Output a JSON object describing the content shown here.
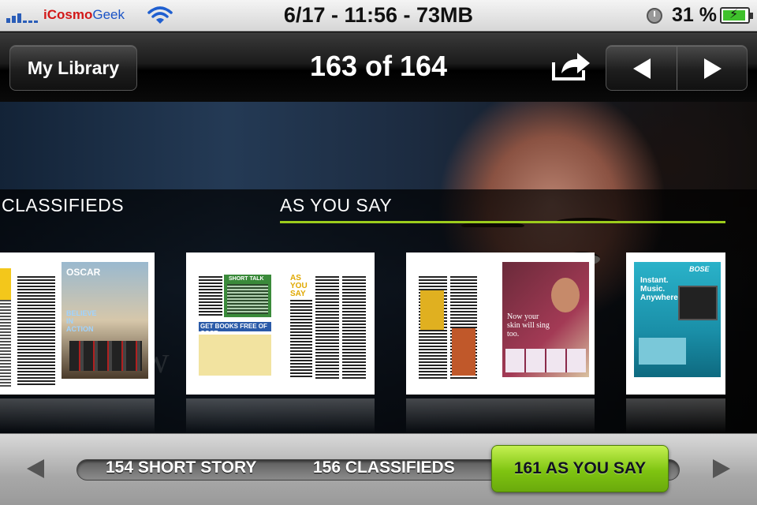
{
  "status_bar": {
    "carrier_part1": "iCosmo",
    "carrier_part2": "Geek",
    "center_text": "6/17 - 11:56 - 73MB",
    "battery_percent": "31 %",
    "battery_level": 0.31,
    "icons": [
      "signal-icon",
      "wifi-icon",
      "clock-icon",
      "battery-icon"
    ]
  },
  "nav": {
    "back_label": "My Library",
    "title": "163 of 164",
    "share_icon": "share-icon",
    "prev_icon": "previous-icon",
    "next_icon": "next-icon"
  },
  "sections": {
    "left_label": "CLASSIFIEDS",
    "right_label": "AS YOU SAY",
    "accent_color": "#9ccc1c"
  },
  "pages": {
    "page2_ad_brand": "OSCAR",
    "page2_ad_text": "BELIEVE IN ACTION",
    "page3_headline": "AS YOU SAY",
    "page3_banner": "GET BOOKS FREE OF COST",
    "page3_box_title": "SHORT TALK",
    "page4_ad_text": "Now your skin will sing too.",
    "page5_brand": "BOSE",
    "page5_ad_text": "Instant. Music. Anywhere."
  },
  "bottom_nav": {
    "items": [
      {
        "label": "154 SHORT STORY",
        "active": false
      },
      {
        "label": "156 CLASSIFIEDS",
        "active": false
      },
      {
        "label": "161 AS YOU SAY",
        "active": true
      }
    ],
    "active_color": "#7fc411"
  }
}
